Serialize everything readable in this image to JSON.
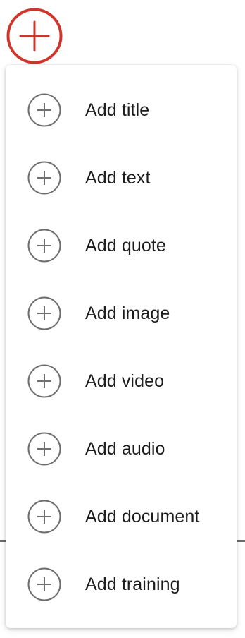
{
  "trigger": {
    "icon": "plus-circle-icon",
    "color": "#d0352b"
  },
  "menu": {
    "item_icon": "plus-circle-icon",
    "icon_color": "#6e6e6e",
    "items": [
      {
        "label": "Add title"
      },
      {
        "label": "Add text"
      },
      {
        "label": "Add quote"
      },
      {
        "label": "Add image"
      },
      {
        "label": "Add video"
      },
      {
        "label": "Add audio"
      },
      {
        "label": "Add document"
      },
      {
        "label": "Add training"
      }
    ]
  }
}
